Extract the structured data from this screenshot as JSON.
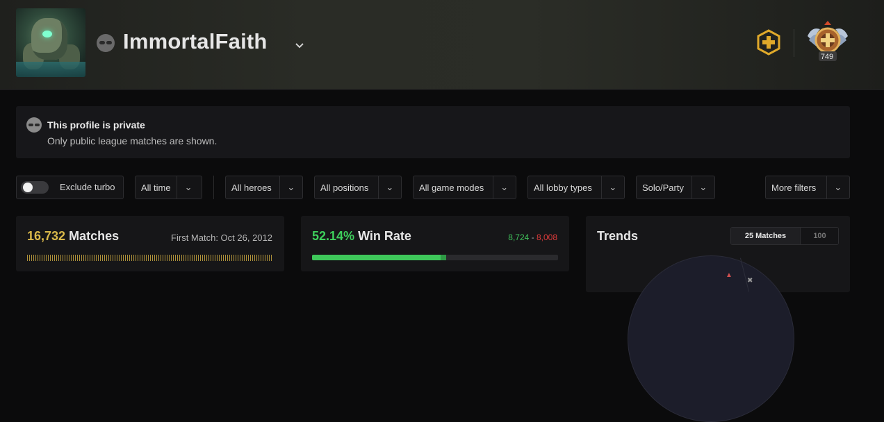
{
  "header": {
    "username": "ImmortalFaith",
    "rank_number": "749"
  },
  "private_notice": {
    "title": "This profile is private",
    "message": "Only public league matches are shown."
  },
  "filters": {
    "exclude_turbo": "Exclude turbo",
    "time": "All time",
    "heroes": "All heroes",
    "positions": "All positions",
    "game_modes": "All game modes",
    "lobby_types": "All lobby types",
    "party": "Solo/Party",
    "more": "More filters",
    "exclude_turbo_on": false
  },
  "matches_card": {
    "count": "16,732",
    "label": "Matches",
    "first_match": "First Match: Oct 26, 2012"
  },
  "winrate_card": {
    "percent": "52.14%",
    "label": "Win Rate",
    "wins": "8,724",
    "separator": " - ",
    "losses": "8,008",
    "win_fraction": 0.5214
  },
  "trends_card": {
    "title": "Trends",
    "tab_active": "25 Matches",
    "tab_inactive": "100"
  },
  "colors": {
    "gold": "#d9b84a",
    "win_green": "#3ecf5c",
    "loss_red": "#e03b3b"
  }
}
